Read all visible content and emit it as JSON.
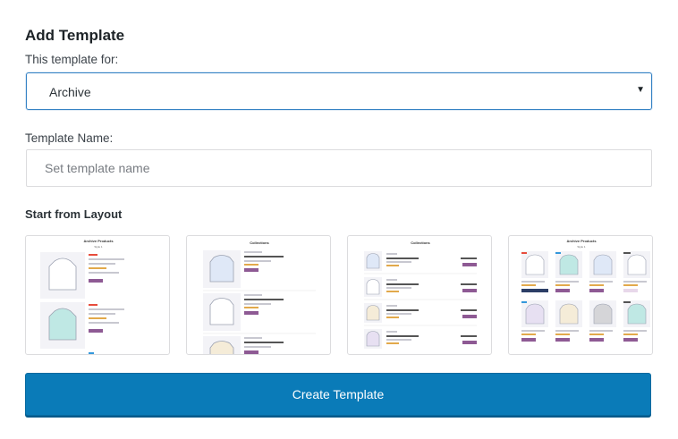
{
  "form": {
    "heading": "Add Template",
    "template_for_label": "This template for:",
    "template_for_value": "Archive",
    "template_name_label": "Template Name:",
    "template_name_placeholder": "Set template name",
    "layout_label": "Start from Layout",
    "submit_label": "Create Template"
  },
  "layouts": [
    {
      "title": "Archive Products",
      "subtitle": "Style 1"
    },
    {
      "title": "Collections",
      "subtitle": ""
    },
    {
      "title": "Collections",
      "subtitle": ""
    },
    {
      "title": "Archive Products",
      "subtitle": "Style 1"
    }
  ],
  "colors": {
    "accent": "#0a7bb8",
    "focus_border": "#3582c4",
    "badge_purple": "#8e5a94",
    "thumb_bg": "#f3f3f7"
  },
  "icons": {
    "select_caret": "▼"
  }
}
